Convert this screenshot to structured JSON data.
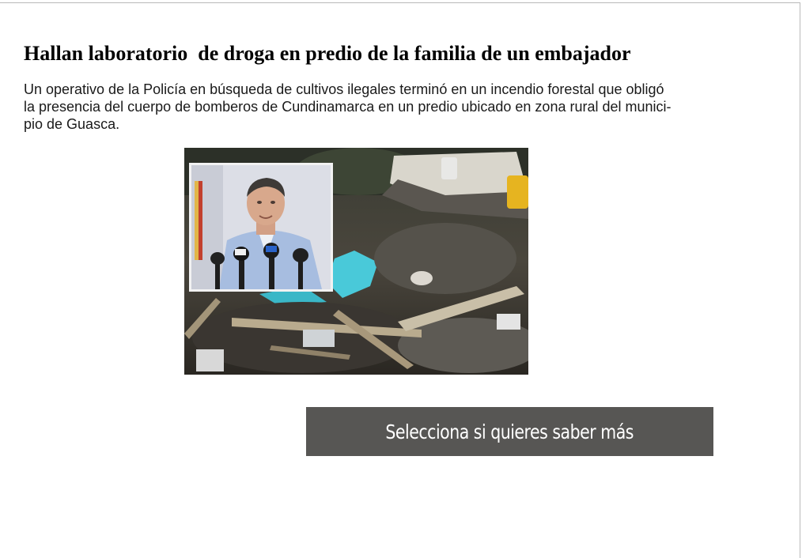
{
  "article": {
    "headline": "Hallan laboratorio  de droga en predio de la familia de un embajador",
    "lead_lines": [
      "Un operativo de la Policía en búsqueda de cultivos ilegales terminó en un incendio forestal que obligó",
      "la presencia del cuerpo de bomberos de Cundinamarca en un predio ubicado en zona rural del munici-",
      "pio de Guasca."
    ]
  },
  "cta": {
    "label": "Selecciona si quieres saber más"
  },
  "colors": {
    "button_bg": "#575654",
    "button_text": "#ffffff",
    "headline": "#000000",
    "body_text": "#1a1a1a"
  }
}
